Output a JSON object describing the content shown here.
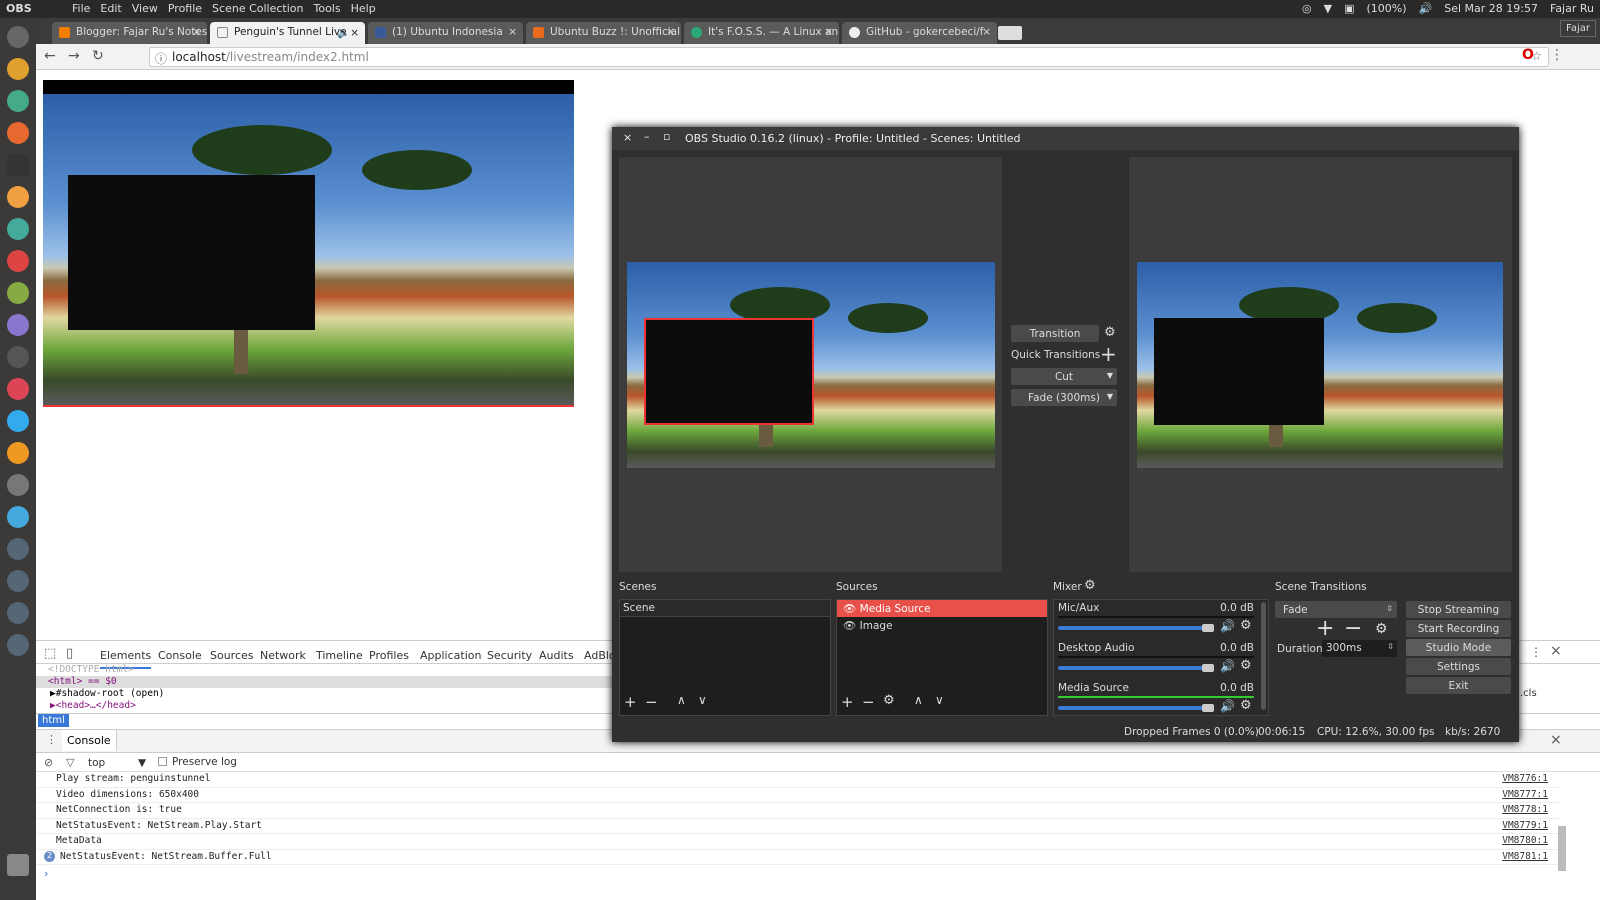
{
  "topbar": {
    "app": "OBS",
    "menu": [
      "File",
      "Edit",
      "View",
      "Profile",
      "Scene Collection",
      "Tools",
      "Help"
    ],
    "battery": "(100%)",
    "datetime": "Sel Mar 28 19:57",
    "user": "Fajar Ru"
  },
  "browser": {
    "tabs": [
      {
        "title": "Blogger: Fajar Ru's Notes",
        "color": "#f57d00"
      },
      {
        "title": "Penguin's Tunnel Live",
        "color": "#ffffff"
      },
      {
        "title": "(1) Ubuntu Indonesia",
        "color": "#3b5998"
      },
      {
        "title": "Ubuntu Buzz !: Unofficial",
        "color": "#e86a1c"
      },
      {
        "title": "It's F.O.S.S. — A Linux and",
        "color": "#2aa876"
      },
      {
        "title": "GitHub - gokercebeci/f",
        "color": "#222222"
      }
    ],
    "profile": "Fajar",
    "url_host": "localhost",
    "url_path": "/livestream/index2.html"
  },
  "devtools": {
    "tabs": [
      "Elements",
      "Console",
      "Sources",
      "Network",
      "Timeline",
      "Profiles",
      "Application",
      "Security",
      "Audits",
      "AdBlock"
    ],
    "dom": {
      "doctype": "<!DOCTYPE html>",
      "html": "<html> == $0",
      "shadow": "#shadow-root (open)",
      "head": "<head>…</head>"
    },
    "breadcrumb": "html",
    "drawer_tab": "Console",
    "context": "top",
    "preserve_log": "Preserve log",
    "cls": ".cls",
    "logs": [
      {
        "text": "Play stream: penguinstunnel",
        "src": "VM8776:1"
      },
      {
        "text": "Video dimensions: 650x400",
        "src": "VM8777:1"
      },
      {
        "text": "NetConnection is: true",
        "src": "VM8778:1"
      },
      {
        "text": "NetStatusEvent: NetStream.Play.Start",
        "src": "VM8779:1"
      },
      {
        "text": "MetaData",
        "src": "VM8780:1"
      },
      {
        "text": "NetStatusEvent: NetStream.Buffer.Full",
        "src": "VM8781:1",
        "count": "2"
      }
    ]
  },
  "obs": {
    "title": "OBS Studio 0.16.2 (linux) - Profile: Untitled - Scenes: Untitled",
    "transition_btn": "Transition",
    "quick_transitions": "Quick Transitions",
    "cut": "Cut",
    "fade300": "Fade (300ms)",
    "scenes": {
      "label": "Scenes",
      "items": [
        "Scene"
      ]
    },
    "sources": {
      "label": "Sources",
      "items": [
        "Media Source",
        "Image"
      ]
    },
    "mixer": {
      "label": "Mixer",
      "channels": [
        {
          "name": "Mic/Aux",
          "db": "0.0 dB"
        },
        {
          "name": "Desktop Audio",
          "db": "0.0 dB"
        },
        {
          "name": "Media Source",
          "db": "0.0 dB"
        }
      ]
    },
    "scene_transitions": {
      "label": "Scene Transitions",
      "selected": "Fade",
      "duration_label": "Duration",
      "duration": "300ms"
    },
    "controls": [
      "Stop Streaming",
      "Start Recording",
      "Studio Mode",
      "Settings",
      "Exit"
    ],
    "status": {
      "dropped": "Dropped Frames 0 (0.0%)",
      "time": "00:06:15",
      "cpu": "CPU: 12.6%, 30.00 fps",
      "kbs": "kb/s: 2670"
    },
    "accent": "#e8504a"
  }
}
